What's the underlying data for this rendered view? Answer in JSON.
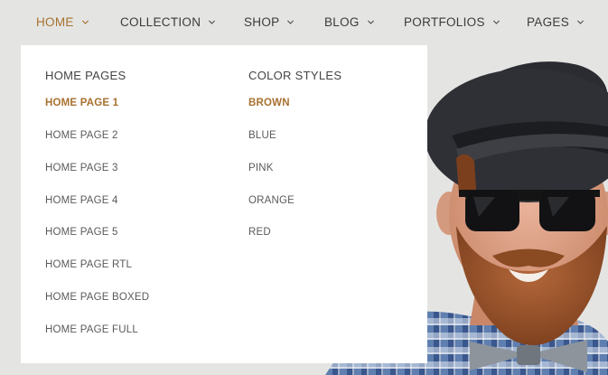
{
  "nav": {
    "items": [
      {
        "label": "HOME",
        "active": true
      },
      {
        "label": "COLLECTION",
        "active": false
      },
      {
        "label": "SHOP",
        "active": false
      },
      {
        "label": "BLOG",
        "active": false
      },
      {
        "label": "PORTFOLIOS",
        "active": false
      },
      {
        "label": "PAGES",
        "active": false
      }
    ]
  },
  "dropdown": {
    "home_pages": {
      "title": "HOME PAGES",
      "links": [
        "HOME PAGE 1",
        "HOME PAGE 2",
        "HOME PAGE 3",
        "HOME PAGE 4",
        "HOME PAGE 5",
        "HOME PAGE RTL",
        "HOME PAGE BOXED",
        "HOME PAGE FULL"
      ]
    },
    "color_styles": {
      "title": "COLOR STYLES",
      "links": [
        "BROWN",
        "BLUE",
        "PINK",
        "ORANGE",
        "RED"
      ]
    }
  },
  "colors": {
    "accent": "#a7712f",
    "background": "#e4e5e3",
    "dropdown_bg": "#ffffff",
    "text": "#444444"
  },
  "icons": {
    "nav_caret": "chevron-down-icon"
  }
}
